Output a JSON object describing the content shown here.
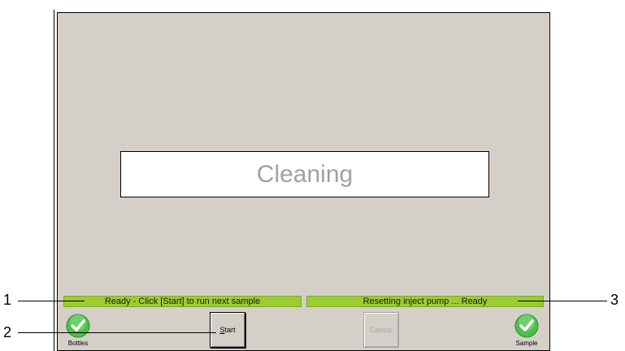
{
  "main": {
    "status_text": "Cleaning"
  },
  "status_bars": {
    "left": "Ready - Click [Start] to run next sample",
    "right": "Resetting inject pump ... Ready"
  },
  "buttons": {
    "start_label": "Start",
    "start_mnemonic": "S",
    "start_rest": "tart",
    "cancel_label": "Cancel"
  },
  "indicators": {
    "bottles_label": "Bottles",
    "sample_label": "Sample",
    "icon": "check-icon",
    "color": "#4cbf4c"
  },
  "callouts": {
    "one": "1",
    "two": "2",
    "three": "3"
  }
}
